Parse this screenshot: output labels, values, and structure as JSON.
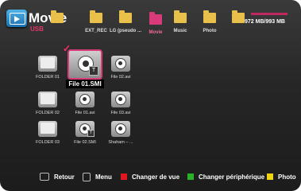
{
  "header": {
    "title": "Movie",
    "subtitle": "USB",
    "devices": [
      {
        "label": "",
        "icon": "folder-icon",
        "selected": false
      },
      {
        "label": "EXT_REC",
        "icon": "folder-icon",
        "selected": false
      },
      {
        "label": "LG (pseudo ...",
        "icon": "folder-icon",
        "selected": false
      },
      {
        "label": "Movie",
        "icon": "folder-icon",
        "selected": true
      },
      {
        "label": "Music",
        "icon": "folder-icon",
        "selected": false
      },
      {
        "label": "Photo",
        "icon": "folder-icon",
        "selected": false
      },
      {
        "label": "",
        "icon": "folder-icon",
        "selected": false
      }
    ],
    "capacity": "972 MB/993 MB"
  },
  "grid": {
    "items": [
      {
        "name": "FOLDER 01",
        "type": "folder"
      },
      {
        "name": "File 01.SMI",
        "type": "video-subtitle",
        "selected": true
      },
      {
        "name": "File 02.avi",
        "type": "video"
      },
      {
        "name": "FOLDER 02",
        "type": "folder"
      },
      {
        "name": "File 01.avi",
        "type": "video"
      },
      {
        "name": "File 03.avi",
        "type": "video"
      },
      {
        "name": "FOLDER 03",
        "type": "folder"
      },
      {
        "name": "File 02.SMI",
        "type": "video-subtitle"
      },
      {
        "name": "Shaham – ...",
        "type": "video"
      }
    ],
    "badge_label": "T"
  },
  "bottom": {
    "back": "Retour",
    "menu": "Menu",
    "red": "Changer de vue",
    "green": "Changer périphérique",
    "yellow": "Photo"
  },
  "colors": {
    "accent": "#d93a7a",
    "red_key": "#e0181e",
    "green_key": "#27b22a",
    "yellow_key": "#f0d414"
  }
}
